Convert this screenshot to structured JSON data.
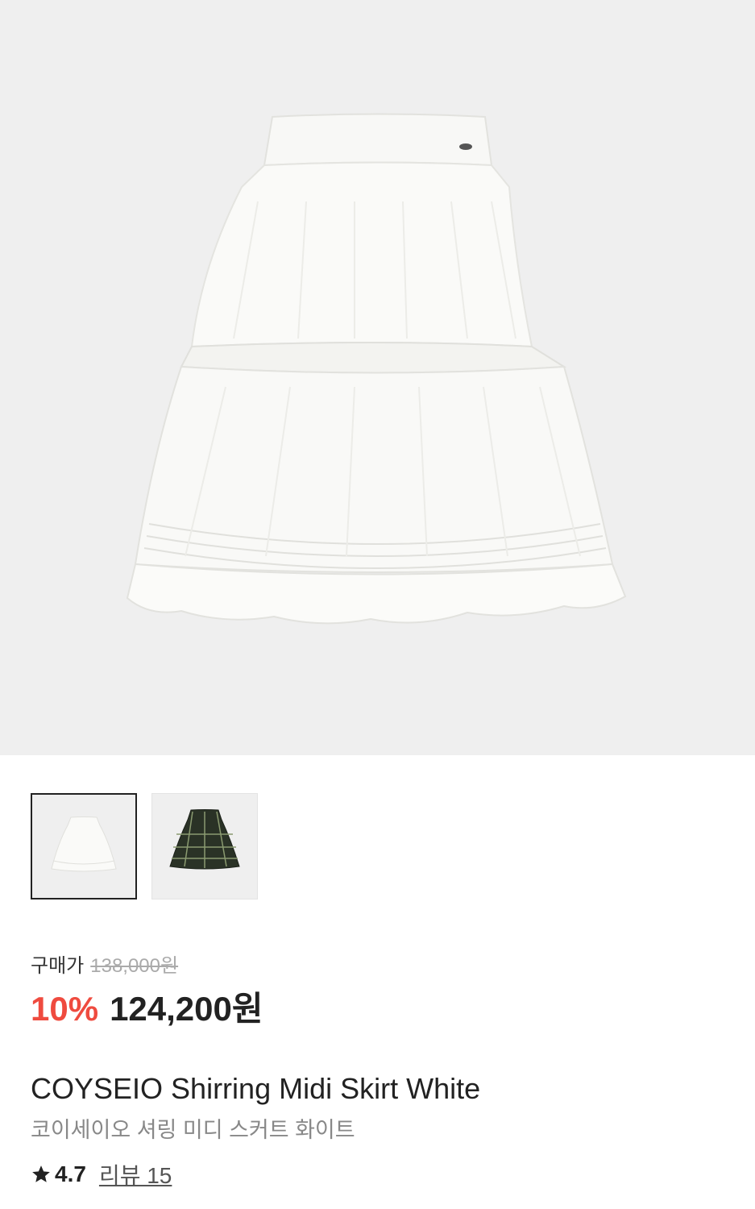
{
  "product": {
    "price_label": "구매가",
    "original_price": "138,000원",
    "discount": "10%",
    "sale_price": "124,200원",
    "title": "COYSEIO Shirring Midi Skirt White",
    "subtitle": "코이세이오 셔링 미디 스커트 화이트",
    "rating": "4.7",
    "review_link": "리뷰 15"
  },
  "thumbnails": [
    {
      "color": "white",
      "selected": true
    },
    {
      "color": "green-check",
      "selected": false
    }
  ],
  "icons": {
    "rating": "star-icon"
  },
  "colors": {
    "accent": "#ef4b3f",
    "hero_bg": "#efefef"
  }
}
